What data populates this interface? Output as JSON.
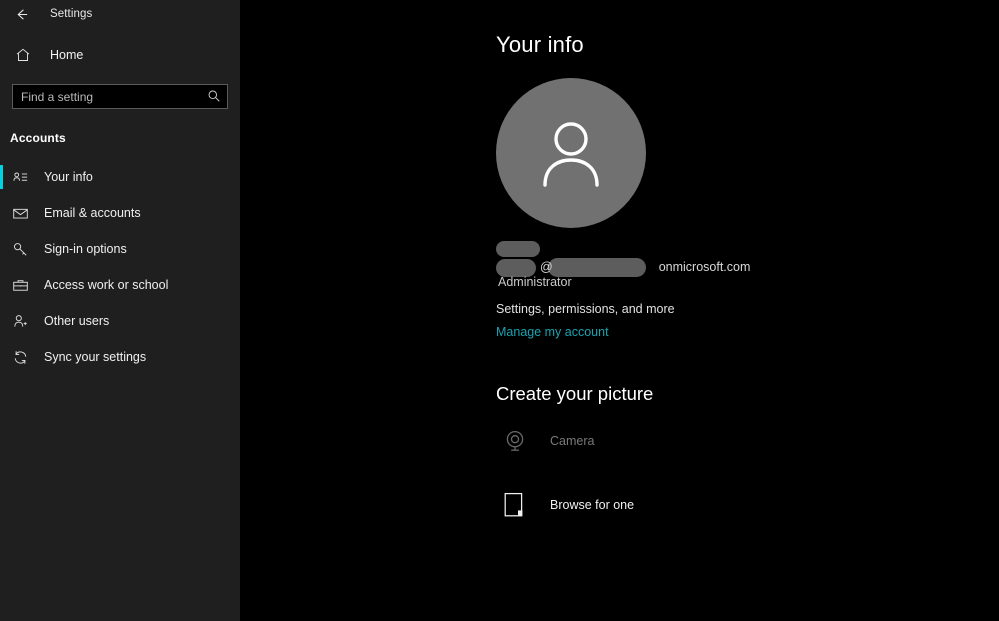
{
  "window": {
    "title": "Settings",
    "back_icon": "back-arrow-icon"
  },
  "sidebar": {
    "home": {
      "label": "Home",
      "icon": "home-icon"
    },
    "search": {
      "placeholder": "Find a setting",
      "value": "",
      "icon": "search-icon"
    },
    "section_heading": "Accounts",
    "items": [
      {
        "label": "Your info",
        "icon": "contact-card-icon",
        "selected": true
      },
      {
        "label": "Email & accounts",
        "icon": "envelope-icon",
        "selected": false
      },
      {
        "label": "Sign-in options",
        "icon": "key-icon",
        "selected": false
      },
      {
        "label": "Access work or school",
        "icon": "briefcase-icon",
        "selected": false
      },
      {
        "label": "Other users",
        "icon": "person-add-icon",
        "selected": false
      },
      {
        "label": "Sync your settings",
        "icon": "sync-icon",
        "selected": false
      }
    ]
  },
  "main": {
    "page_title": "Your info",
    "avatar": {
      "icon": "person-avatar-icon",
      "redacted": true
    },
    "account": {
      "name_redacted": true,
      "email_at": "@",
      "email_domain": "onmicrosoft.com",
      "role": "Administrator"
    },
    "account_links": {
      "description": "Settings, permissions, and more",
      "manage_link": "Manage my account"
    },
    "create_picture": {
      "heading": "Create your picture",
      "options": [
        {
          "label": "Camera",
          "icon": "camera-icon",
          "enabled": false
        },
        {
          "label": "Browse for one",
          "icon": "browse-icon",
          "enabled": true
        }
      ]
    }
  },
  "colors": {
    "accent": "#00d2e0",
    "link": "#19a3b1",
    "sidebar_bg": "#1f1f1f",
    "main_bg": "#000000",
    "avatar_bg": "#717171",
    "redaction": "#5d5d5d"
  }
}
